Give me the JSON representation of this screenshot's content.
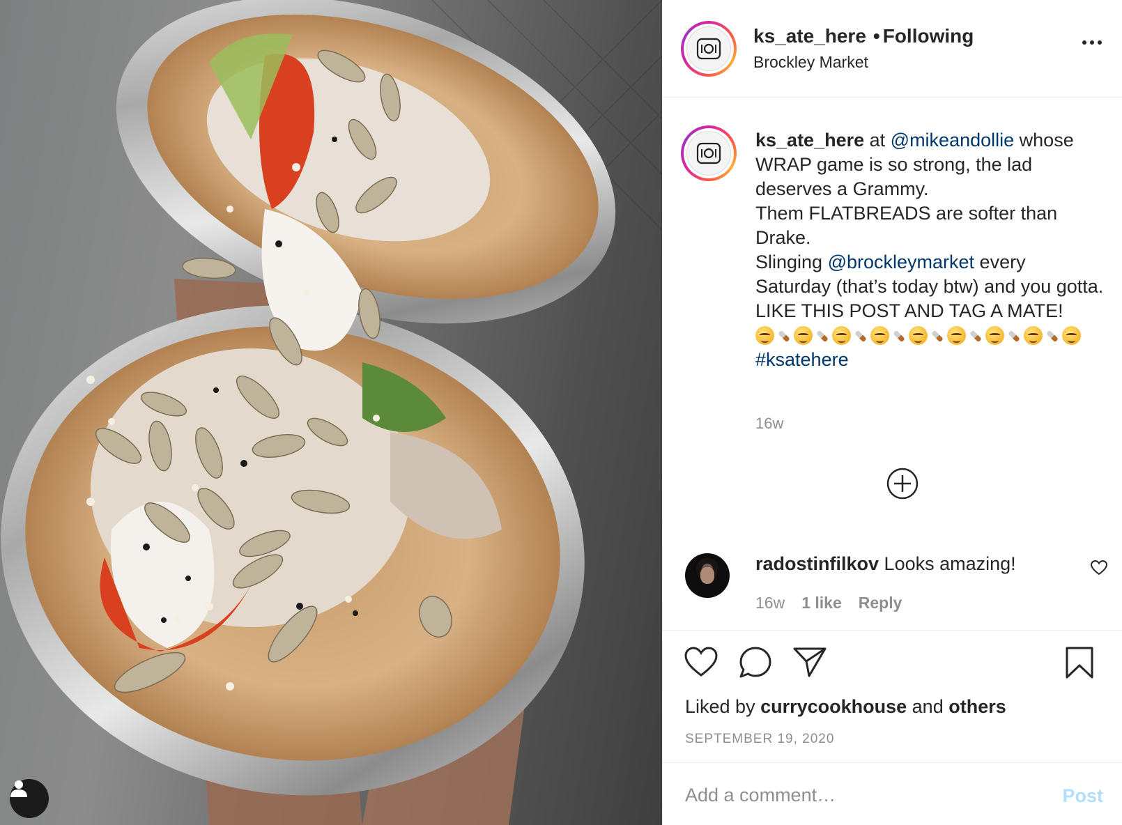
{
  "post": {
    "image_alt": "Wrap cut in half wrapped in foil, topped with sunflower seeds, sesame, yogurt and chilli sauce"
  },
  "header": {
    "username": "ks_ate_here",
    "separator": "•",
    "follow_status": "Following",
    "location": "Brockley Market"
  },
  "caption": {
    "username": "ks_ate_here",
    "t1": " at ",
    "mention1": "@mikeandollie",
    "t2": " whose WRAP game is so strong, the lad deserves a Grammy.",
    "line2": "Them FLATBREADS are softer than Drake.",
    "t3": "Slinging ",
    "mention2": "@brockleymarket",
    "t4": " every Saturday (that’s today btw) and you gotta.",
    "line4": "LIKE THIS POST AND TAG A MATE!",
    "emoji_pattern": [
      "smiling-face-emoji",
      "burrito-emoji",
      "smiling-face-emoji",
      "burrito-emoji",
      "smiling-face-emoji",
      "burrito-emoji",
      "smiling-face-emoji",
      "burrito-emoji",
      "smiling-face-emoji",
      "burrito-emoji",
      "smiling-face-emoji",
      "burrito-emoji",
      "smiling-face-emoji",
      "burrito-emoji",
      "smiling-face-emoji",
      "burrito-emoji",
      "smiling-face-emoji"
    ],
    "hashtag": "#ksatehere",
    "time": "16w"
  },
  "comment": {
    "username": "radostinfilkov",
    "text": "Looks amazing!",
    "time": "16w",
    "likes": "1 like",
    "reply": "Reply"
  },
  "actions": {
    "liked_prefix": "Liked by ",
    "liked_user": "currycookhouse",
    "liked_mid": " and ",
    "liked_others": "others",
    "date": "SEPTEMBER 19, 2020"
  },
  "add_comment": {
    "placeholder": "Add a comment…",
    "post_label": "Post"
  },
  "colors": {
    "link": "#00376b",
    "post_disabled": "#b2dffc",
    "meta_grey": "#8e8e8e"
  }
}
